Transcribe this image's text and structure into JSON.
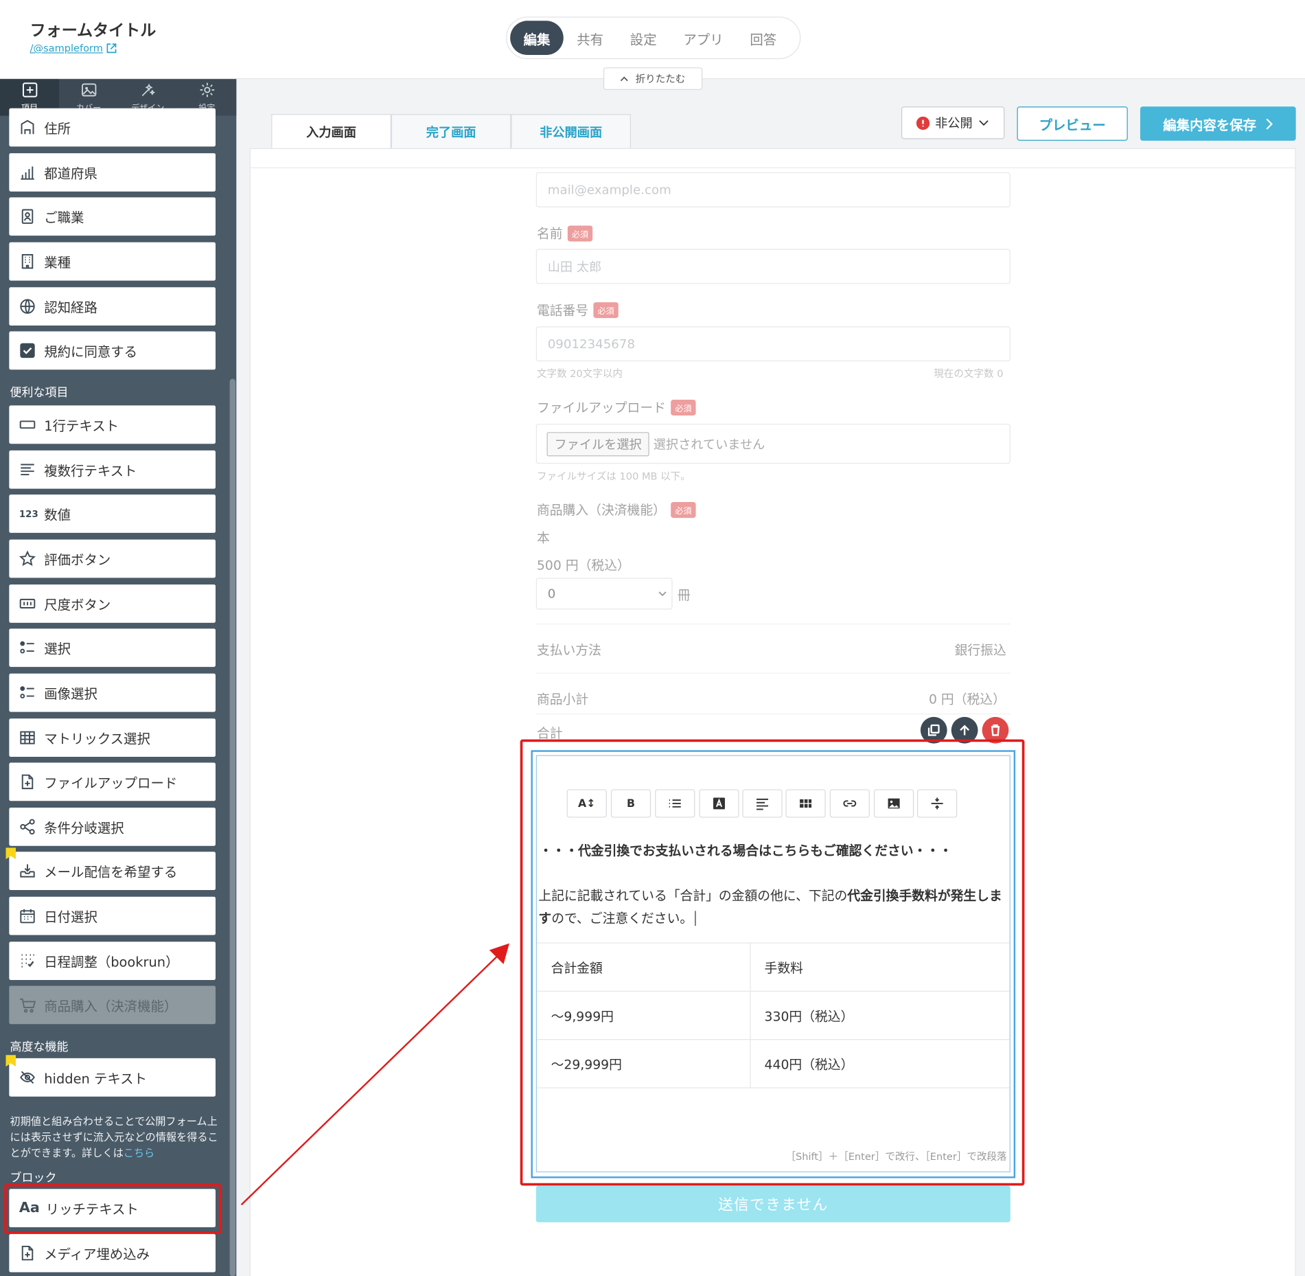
{
  "header": {
    "form_title": "フォームタイトル",
    "form_url": "/@sampleform",
    "nav_tabs": [
      "編集",
      "共有",
      "設定",
      "アプリ",
      "回答"
    ],
    "collapse_label": "折りたたむ"
  },
  "sidebar": {
    "tabs": [
      {
        "label": "項目",
        "icon": "plus-square-icon"
      },
      {
        "label": "カバー",
        "icon": "image-icon"
      },
      {
        "label": "デザイン",
        "icon": "magic-wand-icon"
      },
      {
        "label": "設定",
        "icon": "gear-icon"
      }
    ],
    "items_top": [
      {
        "label": "住所",
        "icon": "building-icon"
      },
      {
        "label": "都道府県",
        "icon": "chart-icon"
      },
      {
        "label": "ご職業",
        "icon": "id-badge-icon"
      },
      {
        "label": "業種",
        "icon": "office-building-icon"
      },
      {
        "label": "認知経路",
        "icon": "globe-icon"
      },
      {
        "label": "規約に同意する",
        "icon": "checkbox-icon"
      }
    ],
    "section_useful": "便利な項目",
    "items_useful": [
      {
        "label": "1行テキスト",
        "icon": "single-line-icon"
      },
      {
        "label": "複数行テキスト",
        "icon": "multi-line-icon"
      },
      {
        "label": "数値",
        "icon": "number-icon"
      },
      {
        "label": "評価ボタン",
        "icon": "star-icon"
      },
      {
        "label": "尺度ボタン",
        "icon": "scale-icon"
      },
      {
        "label": "選択",
        "icon": "select-list-icon"
      },
      {
        "label": "画像選択",
        "icon": "image-select-icon"
      },
      {
        "label": "マトリックス選択",
        "icon": "matrix-icon"
      },
      {
        "label": "ファイルアップロード",
        "icon": "file-plus-icon"
      },
      {
        "label": "条件分岐選択",
        "icon": "share-icon"
      },
      {
        "label": "メール配信を希望する",
        "icon": "inbox-icon"
      },
      {
        "label": "日付選択",
        "icon": "calendar-icon"
      },
      {
        "label": "日程調整（bookrun）",
        "icon": "schedule-icon"
      },
      {
        "label": "商品購入（決済機能）",
        "icon": "cart-icon",
        "disabled": true
      }
    ],
    "section_advanced": "高度な機能",
    "hidden_text_label": "hidden テキスト",
    "hidden_desc": "初期値と組み合わせることで公開フォーム上には表示させずに流入元などの情報を得ることができます。詳しくは",
    "hidden_desc_link": "こちら",
    "section_block": "ブロック",
    "rich_text_label": "リッチテキスト",
    "media_embed_label": "メディア埋め込み"
  },
  "page_tabs": [
    "入力画面",
    "完了画面",
    "非公開画面"
  ],
  "actions": {
    "private_label": "非公開",
    "preview_label": "プレビュー",
    "save_label": "編集内容を保存"
  },
  "form": {
    "email_placeholder": "mail@example.com",
    "name_label": "名前",
    "required": "必須",
    "name_placeholder": "山田 太郎",
    "phone_label": "電話番号",
    "phone_placeholder": "09012345678",
    "phone_hint": "文字数 20文字以内",
    "phone_count": "現在の文字数 0",
    "file_label": "ファイルアップロード",
    "file_button": "ファイルを選択",
    "file_none": "選択されていません",
    "file_hint": "ファイルサイズは 100 MB 以下。",
    "purchase_label": "商品購入（決済機能）",
    "unit": "本",
    "price": "500 円（税込）",
    "qty_value": "0",
    "qty_unit": "冊",
    "payment_label": "支払い方法",
    "payment_value": "銀行振込",
    "subtotal_label": "商品小計",
    "subtotal_value": "0 円（税込）",
    "total_label": "合計",
    "submit_label": "送信できません"
  },
  "rich_text": {
    "heading": "・・・代金引換でお支払いされる場合はこちらもご確認ください・・・",
    "para_normal1": "上記に記載されている「合計」の金額の他に、下記の",
    "para_bold": "代金引換手数料が発生します",
    "para_normal2": "ので、ご注意ください。",
    "table_header": [
      "合計金額",
      "手数料"
    ],
    "table_rows": [
      [
        "〜9,999円",
        "330円（税込）"
      ],
      [
        "〜29,999円",
        "440円（税込）"
      ]
    ],
    "hint": "［Shift］＋［Enter］で改行、［Enter］で改段落",
    "toolbar": [
      "font-size-icon",
      "bold-icon",
      "list-icon",
      "text-color-icon",
      "align-icon",
      "table-icon",
      "link-icon",
      "image-icon",
      "divider-icon"
    ],
    "toolbar_text": {
      "bold": "B"
    }
  },
  "colors": {
    "accent": "#29a3c8",
    "save_button": "#46b6d9",
    "sidebar": "#4a5a67",
    "highlight": "#e01b1b",
    "required": "#e05050",
    "submit_disabled": "#9be4f0"
  }
}
